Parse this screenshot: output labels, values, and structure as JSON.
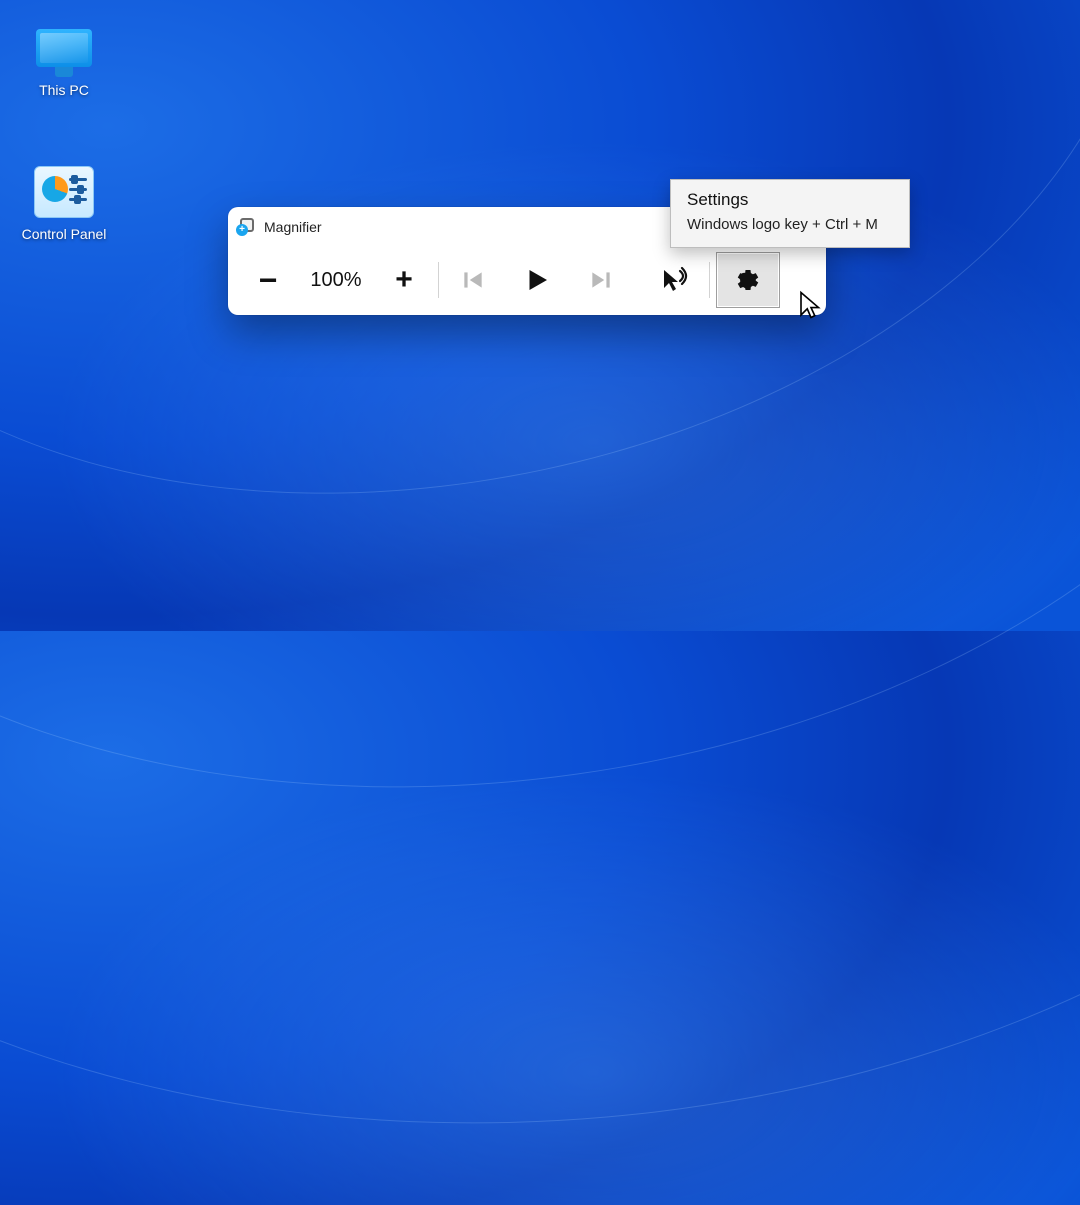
{
  "desktop": {
    "this_pc_label": "This PC",
    "control_panel_label": "Control Panel"
  },
  "magnifier": {
    "title": "Magnifier",
    "zoom_level": "100%",
    "buttons": {
      "zoom_out": "−",
      "zoom_in": "+",
      "minimize": "—"
    }
  },
  "tooltip": {
    "title": "Settings",
    "shortcut": "Windows logo key + Ctrl + M"
  }
}
